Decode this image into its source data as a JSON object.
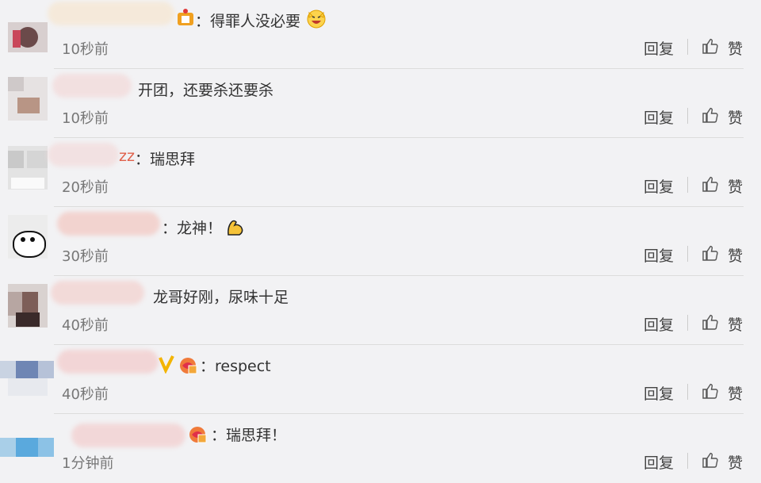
{
  "actions": {
    "reply": "回复",
    "like": "赞"
  },
  "comments": [
    {
      "prefix": "",
      "text": "：得罪人没必要",
      "time": "10秒前"
    },
    {
      "prefix": "",
      "text": "开团，还要杀还要杀",
      "time": "10秒前"
    },
    {
      "prefix": "zz",
      "text": "：瑞思拜",
      "time": "20秒前"
    },
    {
      "prefix": "",
      "text": "：龙神！",
      "time": "30秒前"
    },
    {
      "prefix": "",
      "text": "龙哥好刚，尿味十足",
      "time": "40秒前"
    },
    {
      "prefix": "",
      "text": "：respect",
      "time": "40秒前"
    },
    {
      "prefix": "",
      "text": "：瑞思拜！",
      "time": "1分钟前"
    }
  ]
}
